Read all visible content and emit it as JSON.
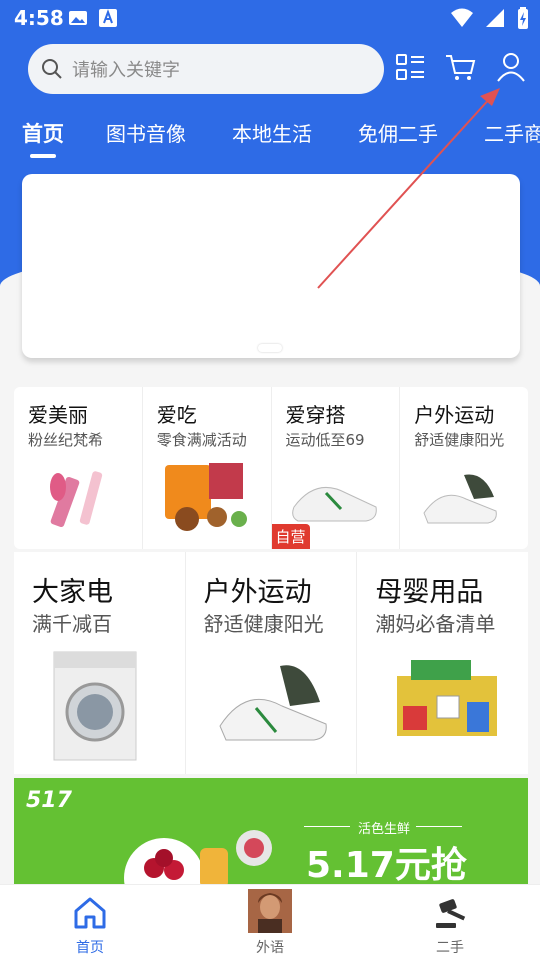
{
  "status_bar": {
    "time": "4:58"
  },
  "search": {
    "placeholder": "请输入关键字"
  },
  "tabs": [
    "首页",
    "图书音像",
    "本地生活",
    "免佣二手",
    "二手商"
  ],
  "grid_small": [
    {
      "title": "爱美丽",
      "subtitle": "粉丝纪梵希"
    },
    {
      "title": "爱吃",
      "subtitle": "零食满减活动"
    },
    {
      "title": "爱穿搭",
      "subtitle": "运动低至69",
      "badge": "自营"
    },
    {
      "title": "户外运动",
      "subtitle": "舒适健康阳光"
    }
  ],
  "grid_large": [
    {
      "title": "大家电",
      "subtitle": "满千减百"
    },
    {
      "title": "户外运动",
      "subtitle": "舒适健康阳光"
    },
    {
      "title": "母婴用品",
      "subtitle": "潮妈必备清单"
    }
  ],
  "promo": {
    "logo": "517",
    "small": "活色生鲜",
    "big": "5.17元抢"
  },
  "nav": [
    "首页",
    "外语",
    "二手"
  ],
  "colors": {
    "accent": "#2e6be6",
    "promo": "#64c133",
    "badge": "#e03a2f"
  }
}
